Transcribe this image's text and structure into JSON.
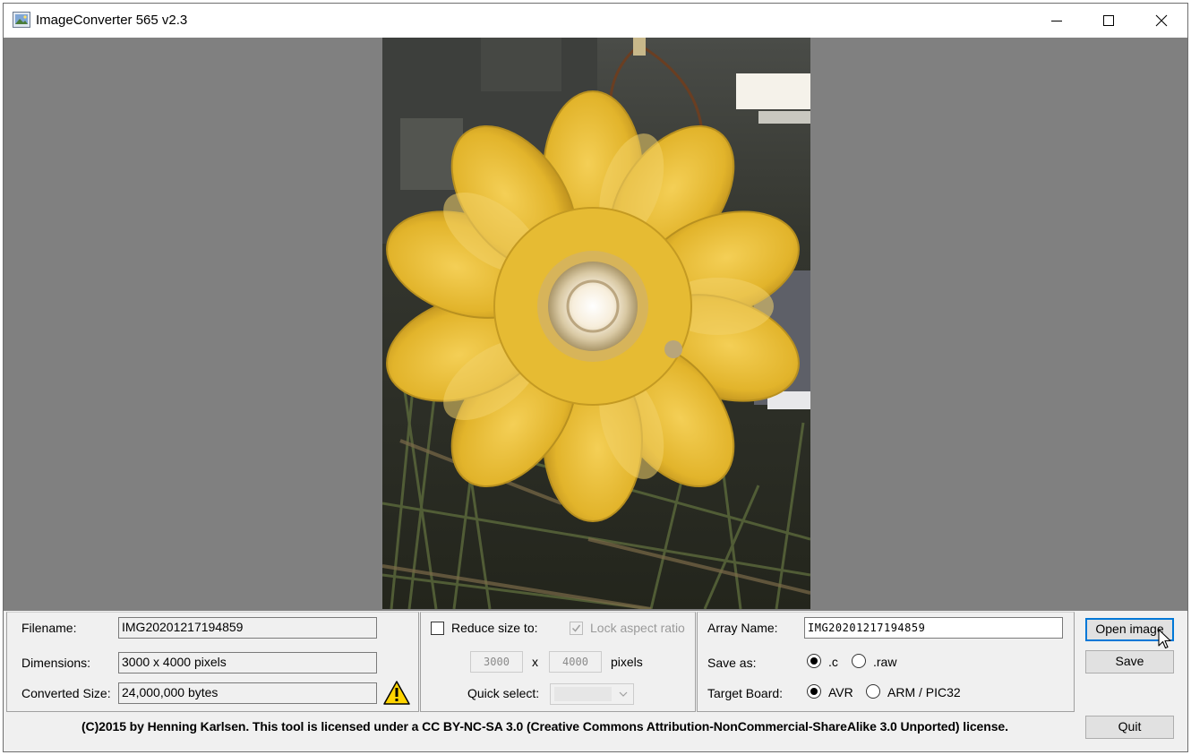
{
  "window": {
    "title": "ImageConverter 565 v2.3",
    "minimize_glyph": "—",
    "close_glyph": "✕"
  },
  "image_info": {
    "filename_label": "Filename:",
    "filename_value": "IMG20201217194859",
    "dimensions_label": "Dimensions:",
    "dimensions_value": "3000 x 4000 pixels",
    "converted_size_label": "Converted Size:",
    "converted_size_value": "24,000,000 bytes",
    "warning_icon": "warning-icon"
  },
  "resize": {
    "reduce_label": "Reduce size to:",
    "reduce_checked": false,
    "lock_label": "Lock aspect ratio",
    "lock_checked": true,
    "width_value": "3000",
    "x_label": "x",
    "height_value": "4000",
    "pixels_label": "pixels",
    "quick_select_label": "Quick select:",
    "quick_select_value": ""
  },
  "output": {
    "array_name_label": "Array Name:",
    "array_name_value": "IMG20201217194859",
    "save_as_label": "Save as:",
    "save_as_options": [
      ".c",
      ".raw"
    ],
    "save_as_selected": ".c",
    "target_board_label": "Target Board:",
    "target_board_options": [
      "AVR",
      "ARM / PIC32"
    ],
    "target_board_selected": "AVR"
  },
  "buttons": {
    "open_image": "Open image",
    "save": "Save",
    "quit": "Quit"
  },
  "footer": {
    "license_text": "(C)2015 by Henning Karlsen. This tool is licensed under a CC BY-NC-SA 3.0 (Creative Commons Attribution-NonCommercial-ShareAlike 3.0 Unported) license."
  },
  "colors": {
    "preview_background": "#808080",
    "focus_border": "#0078d7",
    "flower_yellow": "#e8b82c"
  }
}
